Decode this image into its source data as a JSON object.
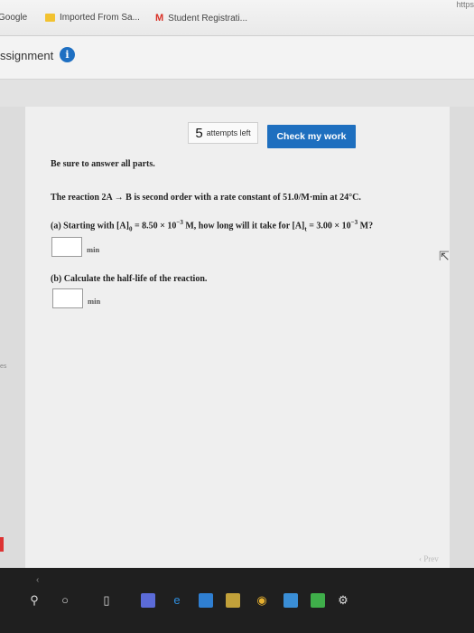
{
  "bookmarks": {
    "items": [
      {
        "label": "Google",
        "icon": "google-icon"
      },
      {
        "label": "Imported From Sa...",
        "icon": "folder-icon"
      },
      {
        "label": "Student Registrati...",
        "icon": "gmail-icon"
      }
    ],
    "url_tail": "https"
  },
  "header": {
    "title": "ssignment",
    "info_glyph": "i"
  },
  "attempts": {
    "count": "5",
    "label": "attempts left"
  },
  "check_button": "Check my work",
  "question": {
    "instruction": "Be sure to answer all parts.",
    "reaction": "The reaction 2A → B is second order with a rate constant of 51.0/M·min at 24°C.",
    "part_a_prefix": "(a) Starting with [A]",
    "part_a_sub0": "0",
    "part_a_mid": " = 8.50 × 10",
    "part_a_exp": "−3",
    "part_a_mid2": " M, how long will it take for [A]",
    "part_a_subt": "t",
    "part_a_mid3": " = 3.00 × 10",
    "part_a_exp2": "−3",
    "part_a_end": " M?",
    "part_a_unit": "min",
    "part_b": "(b) Calculate the half-life of the reaction.",
    "part_b_unit": "min"
  },
  "left_marker": "es",
  "prev_label": "Prev",
  "taskbar_icons": [
    "search-icon",
    "cortana-icon",
    "task-view-icon",
    "store-icon",
    "edge-icon",
    "mail-icon",
    "photos-icon",
    "chrome-icon",
    "app-icon",
    "media-icon",
    "settings-icon"
  ]
}
